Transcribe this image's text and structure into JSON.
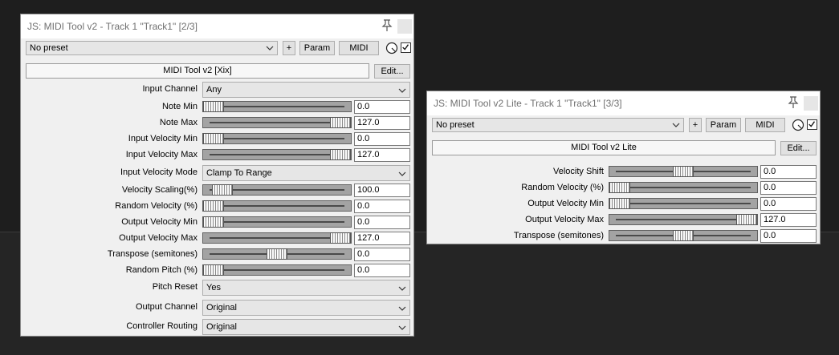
{
  "win1": {
    "title": "JS: MIDI Tool v2 - Track 1 \"Track1\" [2/3]",
    "preset": "No preset",
    "add_label": "+",
    "param_label": "Param",
    "midi_label": "MIDI",
    "fx_name": "MIDI Tool v2 [Xix]",
    "edit_label": "Edit...",
    "rows": [
      {
        "type": "drop",
        "label": "Input Channel",
        "value": "Any"
      },
      {
        "type": "slider",
        "label": "Note Min",
        "value": "0.0",
        "pos": 0
      },
      {
        "type": "slider",
        "label": "Note Max",
        "value": "127.0",
        "pos": 1
      },
      {
        "type": "slider",
        "label": "Input Velocity Min",
        "value": "0.0",
        "pos": 0
      },
      {
        "type": "slider",
        "label": "Input Velocity Max",
        "value": "127.0",
        "pos": 1
      },
      {
        "type": "drop",
        "label": "Input Velocity Mode",
        "value": "Clamp To Range"
      },
      {
        "type": "slider",
        "label": "Velocity Scaling(%)",
        "value": "100.0",
        "pos": 0.07
      },
      {
        "type": "slider",
        "label": "Random Velocity (%)",
        "value": "0.0",
        "pos": 0
      },
      {
        "type": "slider",
        "label": "Output Velocity Min",
        "value": "0.0",
        "pos": 0
      },
      {
        "type": "slider",
        "label": "Output Velocity Max",
        "value": "127.0",
        "pos": 1
      },
      {
        "type": "slider",
        "label": "Transpose (semitones)",
        "value": "0.0",
        "pos": 0.5
      },
      {
        "type": "slider",
        "label": "Random Pitch (%)",
        "value": "0.0",
        "pos": 0
      },
      {
        "type": "drop",
        "label": "Pitch Reset",
        "value": "Yes"
      },
      {
        "type": "drop",
        "label": "Output Channel",
        "value": "Original"
      },
      {
        "type": "drop",
        "label": "Controller Routing",
        "value": "Original"
      }
    ]
  },
  "win2": {
    "title": "JS: MIDI Tool v2 Lite - Track 1 \"Track1\" [3/3]",
    "preset": "No preset",
    "add_label": "+",
    "param_label": "Param",
    "midi_label": "MIDI",
    "fx_name": "MIDI Tool v2 Lite",
    "edit_label": "Edit...",
    "rows": [
      {
        "type": "slider",
        "label": "Velocity Shift",
        "value": "0.0",
        "pos": 0.5
      },
      {
        "type": "slider",
        "label": "Random Velocity (%)",
        "value": "0.0",
        "pos": 0
      },
      {
        "type": "slider",
        "label": "Output Velocity Min",
        "value": "0.0",
        "pos": 0
      },
      {
        "type": "slider",
        "label": "Output Velocity Max",
        "value": "127.0",
        "pos": 1
      },
      {
        "type": "slider",
        "label": "Transpose (semitones)",
        "value": "0.0",
        "pos": 0.5
      }
    ]
  },
  "icons": {
    "pin": "pin-icon",
    "close": "close-icon",
    "knob": "wet-knob-icon",
    "chevron": "chevron-down-icon",
    "checkbox": "bypass-checkbox"
  }
}
